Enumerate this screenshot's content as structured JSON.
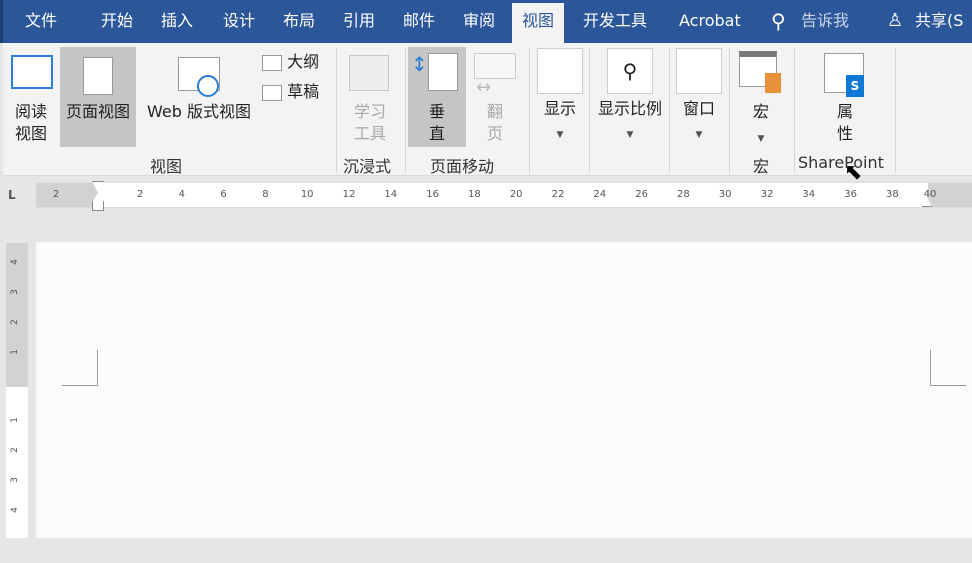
{
  "tabs": [
    "文件",
    "开始",
    "插入",
    "设计",
    "布局",
    "引用",
    "邮件",
    "审阅",
    "视图",
    "开发工具",
    "Acrobat"
  ],
  "active_tab": "视图",
  "tell_me": "告诉我",
  "share": "共享(S",
  "ribbon": {
    "read_view": [
      "阅读",
      "视图"
    ],
    "print_layout": "页面视图",
    "web_layout": "Web 版式视图",
    "outline": "大纲",
    "draft": "草稿",
    "learning_tools": [
      "学习",
      "工具"
    ],
    "vertical": [
      "垂",
      "直"
    ],
    "side_to_side": [
      "翻",
      "页"
    ],
    "show": "显示",
    "zoom": "显示比例",
    "window": "窗口",
    "macros": "宏",
    "properties": [
      "属",
      "性"
    ],
    "groups": {
      "views": "视图",
      "immersive": "沉浸式",
      "page_movement": "页面移动",
      "macros": "宏",
      "sharepoint": "SharePoint"
    }
  },
  "ruler": {
    "left_margin": "2",
    "marks": [
      "2",
      "4",
      "6",
      "8",
      "10",
      "12",
      "14",
      "16",
      "18",
      "20",
      "22",
      "24",
      "26",
      "28",
      "30",
      "32",
      "34",
      "36",
      "38"
    ],
    "right_margin": "40"
  },
  "vruler": {
    "top": [
      "4",
      "3",
      "2",
      "1"
    ],
    "bottom": [
      "1",
      "2",
      "3",
      "4"
    ]
  }
}
